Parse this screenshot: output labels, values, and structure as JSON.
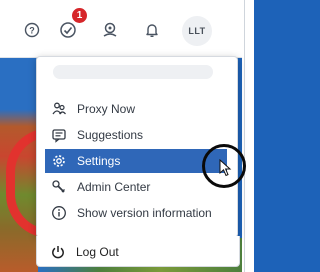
{
  "header": {
    "notification_count": "1",
    "user_initials": "LLT",
    "icons": [
      "help-icon",
      "tasks-icon",
      "workflow-icon",
      "bell-icon"
    ]
  },
  "menu": {
    "items": [
      {
        "label": "Proxy Now",
        "icon": "proxy-icon"
      },
      {
        "label": "Suggestions",
        "icon": "suggestions-icon"
      },
      {
        "label": "Settings",
        "icon": "settings-gear-icon",
        "active": true
      },
      {
        "label": "Admin Center",
        "icon": "admin-wrench-icon"
      },
      {
        "label": "Show version information",
        "icon": "info-icon"
      },
      {
        "label": "Log Out",
        "icon": "power-icon"
      }
    ]
  },
  "colors": {
    "active_bg": "#2f67b8",
    "badge": "#d6262a",
    "page_background": "#1d62b8"
  }
}
